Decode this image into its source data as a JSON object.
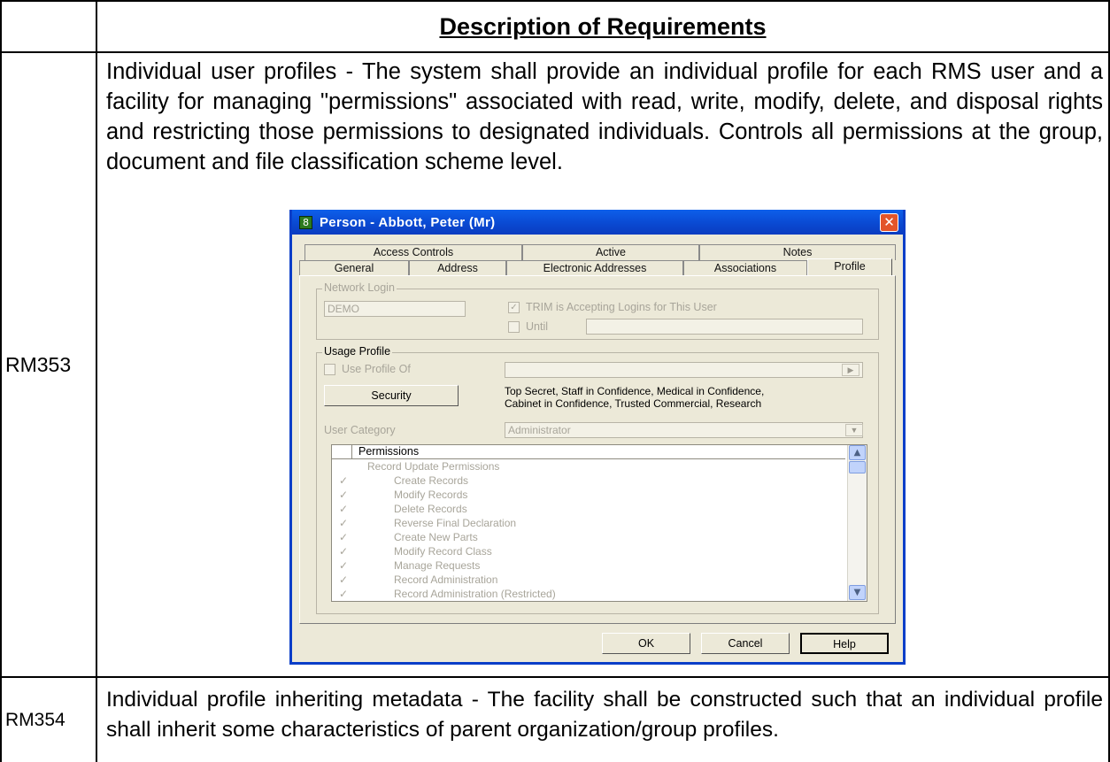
{
  "document": {
    "header": "Description of Requirements",
    "rows": [
      {
        "id": "RM353",
        "text": "Individual user profiles - The system shall provide an individual profile for each RMS user and a facility for managing \"permissions\" associated with read, write, modify, delete, and disposal rights and restricting those permissions to designated individuals. Controls all permissions at the group, document and file classification scheme level."
      },
      {
        "id": "RM354",
        "text": "Individual profile inheriting metadata - The facility shall be constructed such that an individual profile shall inherit some characteristics of parent organization/group profiles."
      }
    ]
  },
  "window": {
    "title": "Person - Abbott, Peter (Mr)",
    "close_glyph": "✕",
    "title_icon_glyph": "8",
    "tabs_back": [
      "Access Controls",
      "Active",
      "Notes"
    ],
    "tabs_front": [
      "General",
      "Address",
      "Electronic Addresses",
      "Associations",
      "Profile"
    ],
    "active_tab": "Profile",
    "network_login": {
      "group_label": "Network Login",
      "login_value": "DEMO",
      "accepting_label": "TRIM is Accepting Logins for This User",
      "accepting_checked": true,
      "until_label": "Until",
      "until_value": ""
    },
    "usage_profile": {
      "group_label": "Usage Profile",
      "use_profile_label": "Use Profile Of",
      "use_profile_checked": false,
      "security_button": "Security",
      "security_text_line1": "Top Secret, Staff in Confidence, Medical in Confidence,",
      "security_text_line2": "Cabinet in Confidence, Trusted Commercial, Research",
      "user_category_label": "User Category",
      "user_category_value": "Administrator"
    },
    "permissions": {
      "header": "Permissions",
      "items": [
        {
          "label": "Record Update Permissions",
          "checked": false
        },
        {
          "label": "Create Records",
          "checked": true
        },
        {
          "label": "Modify Records",
          "checked": true
        },
        {
          "label": "Delete Records",
          "checked": true
        },
        {
          "label": "Reverse Final Declaration",
          "checked": true
        },
        {
          "label": "Create New Parts",
          "checked": true
        },
        {
          "label": "Modify Record Class",
          "checked": true
        },
        {
          "label": "Manage Requests",
          "checked": true
        },
        {
          "label": "Record Administration",
          "checked": true
        },
        {
          "label": "Record Administration (Restricted)",
          "checked": true
        }
      ]
    },
    "buttons": {
      "ok": "OK",
      "cancel": "Cancel",
      "help": "Help"
    }
  }
}
